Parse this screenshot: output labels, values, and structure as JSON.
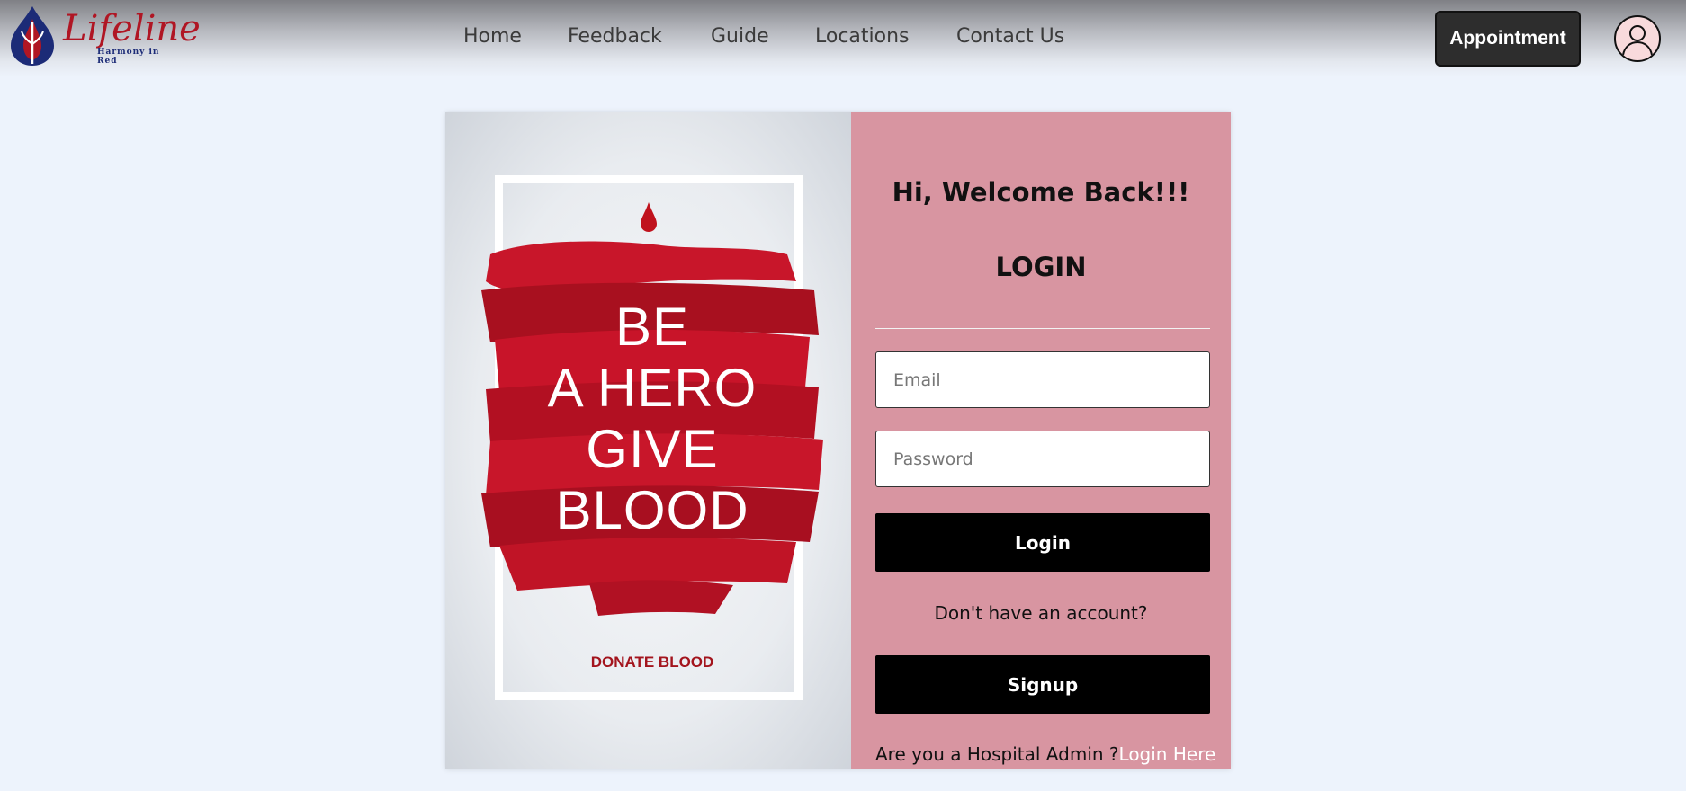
{
  "brand": {
    "name": "Lifeline",
    "tagline": "Harmony in Red"
  },
  "nav": {
    "links": [
      "Home",
      "Feedback",
      "Guide",
      "Locations",
      "Contact Us"
    ],
    "appointment_label": "Appointment"
  },
  "poster": {
    "line1": "BE",
    "line2": "A HERO",
    "line3": "GIVE",
    "line4": "BLOOD",
    "cta": "DONATE BLOOD"
  },
  "login": {
    "welcome": "Hi, Welcome Back!!!",
    "title": "LOGIN",
    "email_placeholder": "Email",
    "password_placeholder": "Password",
    "login_button": "Login",
    "no_account_text": "Don't have an account?",
    "signup_button": "Signup",
    "admin_prompt": "Are you a Hospital Admin ?",
    "admin_link": "Login Here"
  },
  "colors": {
    "page_bg": "#edf3fc",
    "brand_red": "#b01624",
    "brand_navy": "#1c2b77",
    "panel_pink": "#d895a1",
    "button_black": "#000000",
    "appointment_bg": "#2d2d2d"
  },
  "icons": {
    "logo": "blood-drop-leaf-icon",
    "profile": "user-avatar-icon"
  }
}
